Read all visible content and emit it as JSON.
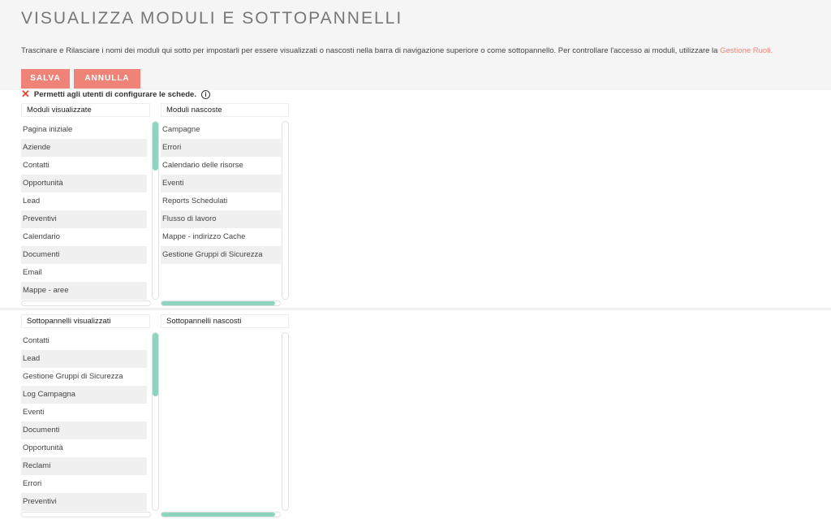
{
  "page": {
    "title": "VISUALIZZA MODULI E SOTTOPANNELLI",
    "description": "Trascinare e Rilasciare i nomi dei moduli qui sotto per impostarli per essere visualizzati o nascosti nella barra di navigazione superiore o come sottopannello. Per controllare l'accesso ai moduli, utilizzare la ",
    "description_link": "Gestione Ruoli."
  },
  "buttons": {
    "save": "SALVA",
    "cancel": "ANNULLA"
  },
  "option": {
    "label": "Permetti agli utenti di configurare le schede.",
    "info_icon": "i"
  },
  "modules": {
    "displayed_header": "Moduli visualizzate",
    "hidden_header": "Moduli nascoste",
    "displayed": [
      "Pagina iniziale",
      "Aziende",
      "Contatti",
      "Opportunità",
      "Lead",
      "Preventivi",
      "Calendario",
      "Documenti",
      "Email",
      "Mappe - aree"
    ],
    "hidden": [
      "Campagne",
      "Errori",
      "Calendario delle risorse",
      "Eventi",
      "Reports Schedulati",
      "Flusso di lavoro",
      "Mappe - indirizzo Cache",
      "Gestione Gruppi di Sicurezza"
    ]
  },
  "subpanels": {
    "displayed_header": "Sottopannelli visualizzati",
    "hidden_header": "Sottopannelli nascosti",
    "displayed": [
      "Contatti",
      "Lead",
      "Gestione Gruppi di Sicurezza",
      "Log Campagna",
      "Eventi",
      "Documenti",
      "Opportunità",
      "Reclami",
      "Errori",
      "Preventivi"
    ],
    "hidden": []
  },
  "colors": {
    "accent": "#f08377",
    "scroll_thumb": "#8fd4c1",
    "error_x": "#e04a3a"
  },
  "icons": {
    "disabled": "close-icon",
    "info": "info-icon"
  }
}
